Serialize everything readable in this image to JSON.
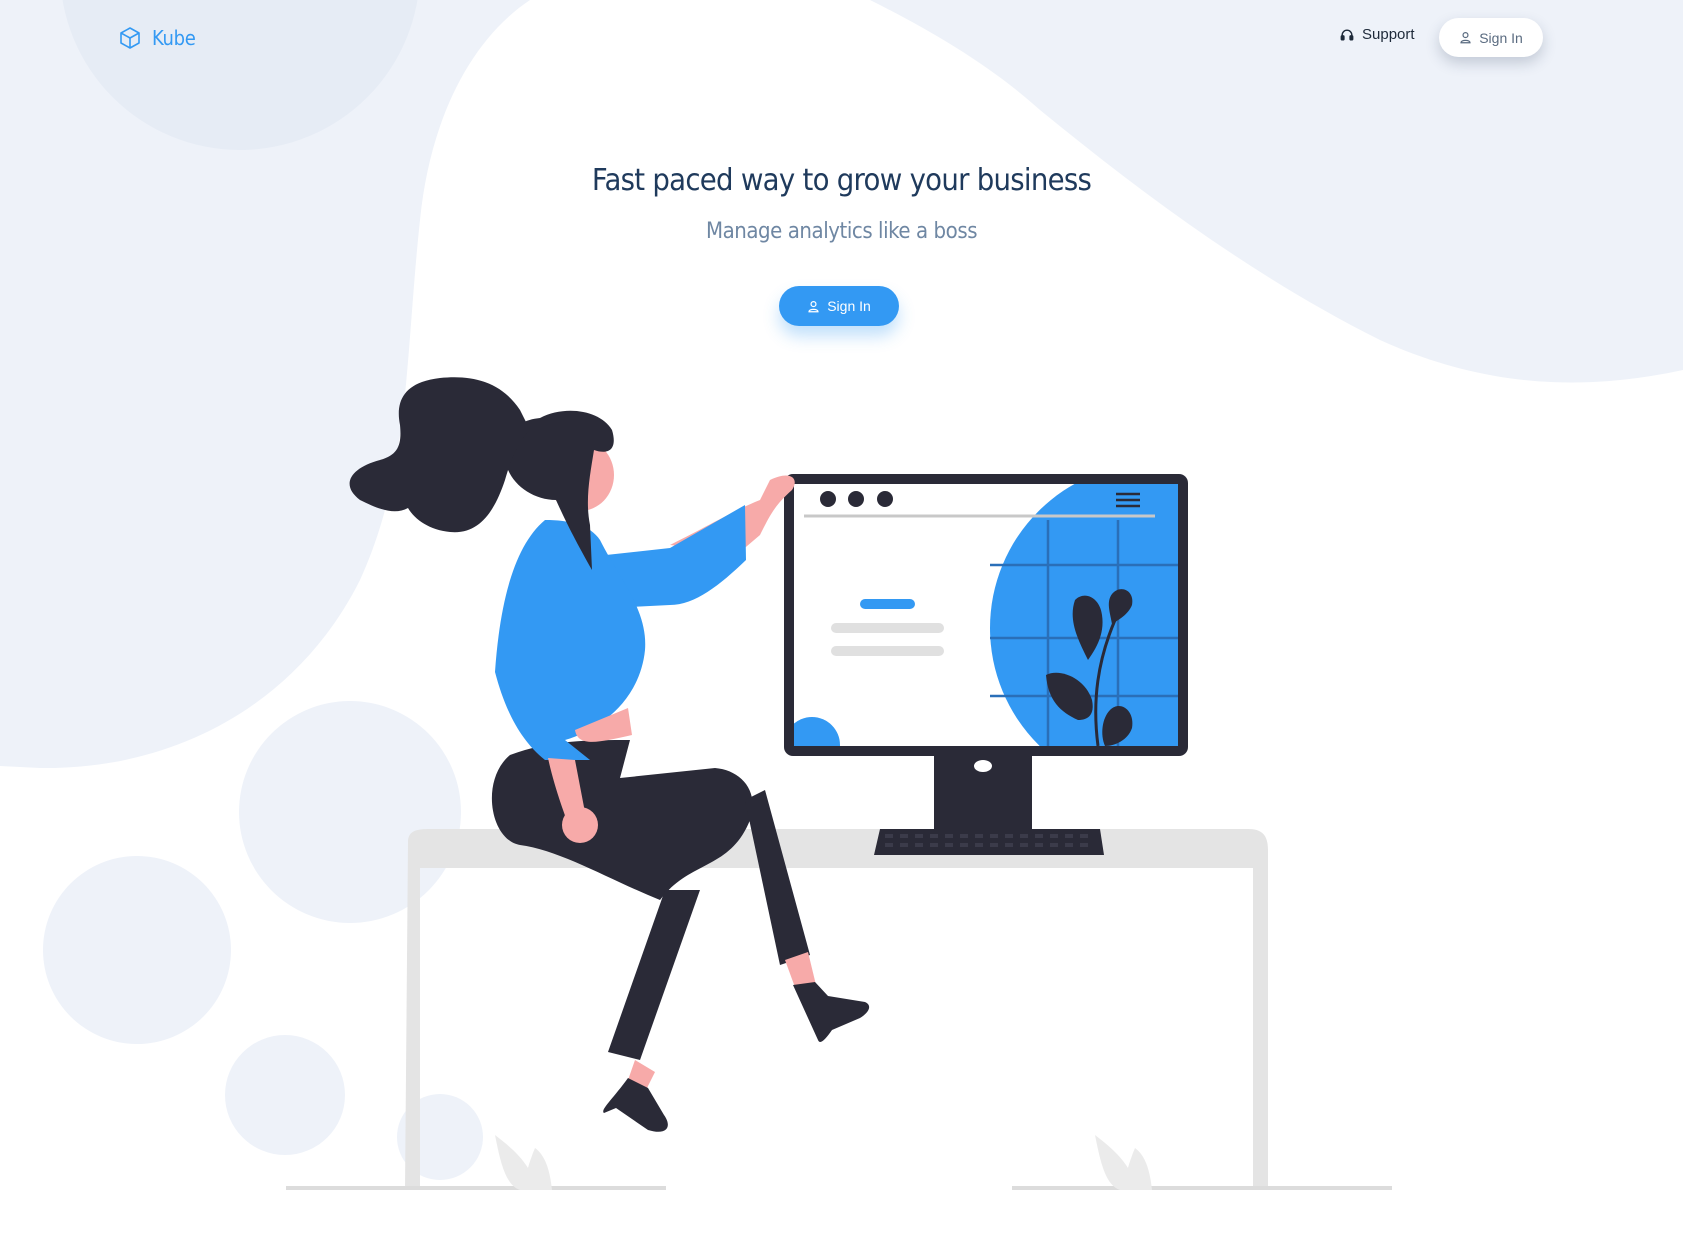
{
  "header": {
    "logo_text": "Kube",
    "logo_icon": "cube-icon",
    "support_label": "Support",
    "support_icon": "headset-icon",
    "signin_label": "Sign In",
    "signin_icon": "user-icon"
  },
  "hero": {
    "title": "Fast paced way to grow your business",
    "subtitle": "Manage analytics like a boss",
    "signin_label": "Sign In",
    "signin_icon": "user-icon"
  },
  "colors": {
    "accent": "#3399f3",
    "title": "#1f3a5c",
    "subtitle": "#6f87a3",
    "background_shape": "#eef2f9",
    "illustration_dark": "#2a2a37",
    "skin": "#f7aaa9",
    "desk": "#e4e4e4"
  },
  "illustration": {
    "name": "woman-at-computer-desk-illustration"
  }
}
